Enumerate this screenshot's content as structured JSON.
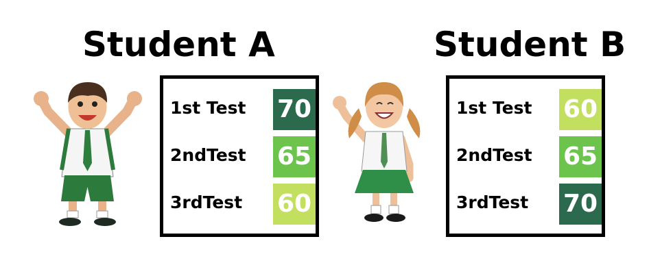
{
  "student_a": {
    "title": "Student A",
    "tests": [
      {
        "label": "1st Test",
        "value": "70",
        "color": "#2b6a4c"
      },
      {
        "label": "2ndTest",
        "value": "65",
        "color": "#6cc44d"
      },
      {
        "label": "3rdTest",
        "value": "60",
        "color": "#c3df5f"
      }
    ]
  },
  "student_b": {
    "title": "Student B",
    "tests": [
      {
        "label": "1st Test",
        "value": "60",
        "color": "#c3df5f"
      },
      {
        "label": "2ndTest",
        "value": "65",
        "color": "#6cc44d"
      },
      {
        "label": "3rdTest",
        "value": "70",
        "color": "#2b6a4c"
      }
    ]
  },
  "icons": {
    "student_a_image": "boy-student-icon",
    "student_b_image": "girl-student-icon"
  }
}
